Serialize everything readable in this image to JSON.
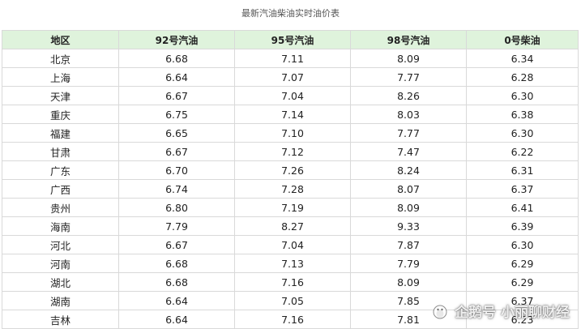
{
  "title": "最新汽油柴油实时油价表",
  "table": {
    "headers": [
      "地区",
      "92号汽油",
      "95号汽油",
      "98号汽油",
      "0号柴油"
    ],
    "rows": [
      [
        "北京",
        "6.68",
        "7.11",
        "8.09",
        "6.34"
      ],
      [
        "上海",
        "6.64",
        "7.07",
        "7.77",
        "6.28"
      ],
      [
        "天津",
        "6.67",
        "7.04",
        "8.26",
        "6.30"
      ],
      [
        "重庆",
        "6.75",
        "7.14",
        "8.03",
        "6.38"
      ],
      [
        "福建",
        "6.65",
        "7.10",
        "7.77",
        "6.30"
      ],
      [
        "甘肃",
        "6.67",
        "7.12",
        "7.47",
        "6.22"
      ],
      [
        "广东",
        "6.70",
        "7.26",
        "8.24",
        "6.31"
      ],
      [
        "广西",
        "6.74",
        "7.28",
        "8.07",
        "6.37"
      ],
      [
        "贵州",
        "6.80",
        "7.19",
        "8.09",
        "6.41"
      ],
      [
        "海南",
        "7.79",
        "8.27",
        "9.33",
        "6.39"
      ],
      [
        "河北",
        "6.67",
        "7.04",
        "7.87",
        "6.30"
      ],
      [
        "河南",
        "6.68",
        "7.13",
        "7.79",
        "6.29"
      ],
      [
        "湖北",
        "6.68",
        "7.16",
        "8.09",
        "6.29"
      ],
      [
        "湖南",
        "6.64",
        "7.05",
        "7.85",
        "6.37"
      ],
      [
        "吉林",
        "6.64",
        "7.16",
        "7.81",
        "6.23"
      ]
    ]
  },
  "watermark": {
    "text": "企鹅号 小丽聊财经",
    "icon": "penguin-logo-icon"
  },
  "colors": {
    "header_bg": "#dff3dc",
    "border": "#d9d9d9"
  }
}
